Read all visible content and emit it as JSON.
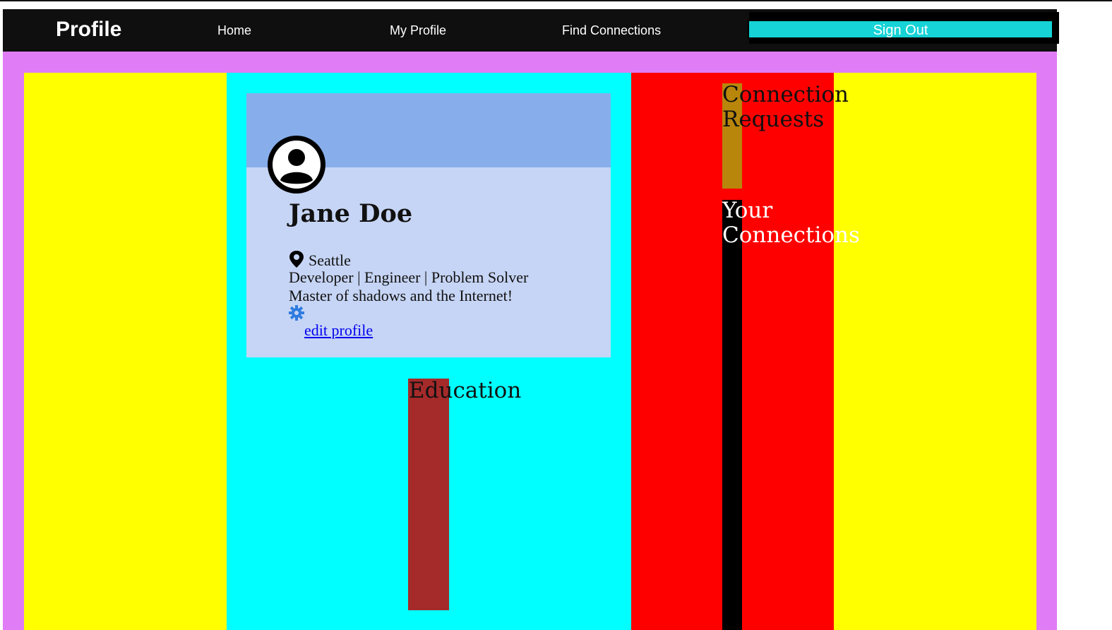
{
  "nav": {
    "brand": "Profile",
    "links": [
      {
        "label": "Home"
      },
      {
        "label": "My Profile"
      },
      {
        "label": "Find Connections"
      }
    ],
    "sign_out_label": "Sign Out"
  },
  "profile": {
    "avatar_icon": "user-avatar-icon",
    "name": "Jane Doe",
    "location_icon": "map-pin-icon",
    "location": "Seattle",
    "tagline": "Developer | Engineer | Problem Solver",
    "bio": "Master of shadows and the Internet!",
    "settings_icon": "gear-icon",
    "edit_link": "edit profile"
  },
  "sections": {
    "education_title": "Education",
    "connection_requests_title": "Connection Requests",
    "your_connections_title": "Your Connections"
  },
  "colors": {
    "navbar_bg": "#0f0f0f",
    "sign_out_bg": "#15d3d6",
    "page_bg": "#e07cf6",
    "left_column": "#ffff00",
    "center_column": "#00ffff",
    "right_column": "#ff0000",
    "far_right_column": "#ffff00",
    "card_banner": "#87aeeb",
    "card_body": "#c6d5f5",
    "education_block": "#a52a2a",
    "requests_block": "#b8860b",
    "connections_block": "#000000",
    "link": "#0000ee",
    "gear": "#2f7ce0"
  }
}
